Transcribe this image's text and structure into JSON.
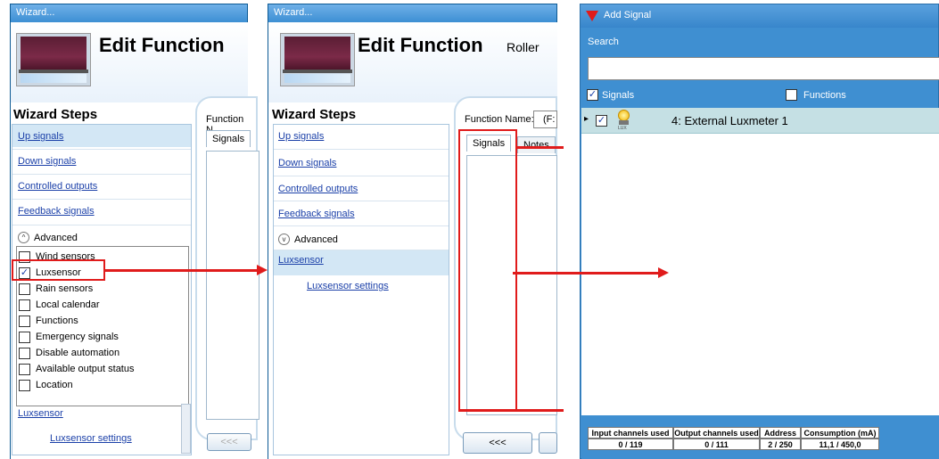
{
  "window1": {
    "title": "Wizard...",
    "header_title": "Edit Function",
    "wizard_steps_title": "Wizard Steps",
    "function_label": "Function N",
    "tab_signals": "Signals",
    "steps": [
      "Up signals",
      "Down signals",
      "Controlled outputs",
      "Feedback signals"
    ],
    "advanced_label": "Advanced",
    "checkboxes": [
      {
        "label": "Wind sensors",
        "checked": false
      },
      {
        "label": "Luxsensor",
        "checked": true
      },
      {
        "label": "Rain sensors",
        "checked": false
      },
      {
        "label": "Local calendar",
        "checked": false
      },
      {
        "label": "Functions",
        "checked": false
      },
      {
        "label": "Emergency signals",
        "checked": false
      },
      {
        "label": "Disable automation",
        "checked": false
      },
      {
        "label": "Available output status",
        "checked": false
      },
      {
        "label": "Location",
        "checked": false
      }
    ],
    "sub_step": "Luxsensor",
    "sub_sub_step": "Luxsensor settings",
    "back_button": "<<<"
  },
  "window2": {
    "title": "Wizard...",
    "header_title": "Edit Function",
    "header_subtitle": "Roller",
    "wizard_steps_title": "Wizard Steps",
    "function_name_label": "Function Name:",
    "function_name_value": "(F:",
    "tab_signals": "Signals",
    "tab_notes": "Notes",
    "steps": [
      "Up signals",
      "Down signals",
      "Controlled outputs",
      "Feedback signals"
    ],
    "advanced_label": "Advanced",
    "sub_step": "Luxsensor",
    "sub_sub_step": "Luxsensor settings",
    "back_button": "<<<"
  },
  "add_signal": {
    "title": "Add Signal",
    "search_label": "Search",
    "search_value": "",
    "signals_checkbox": "Signals",
    "signals_checked": true,
    "functions_checkbox": "Functions",
    "functions_checked": false,
    "row_label": "4: External Luxmeter 1",
    "row_checked": true,
    "icon_caption": "LUX",
    "table_headers": [
      "Input channels used",
      "Output channels used",
      "Address",
      "Consumption (mA)"
    ],
    "table_values": [
      "0 / 119",
      "0 / 111",
      "2 / 250",
      "11,1 / 450,0"
    ]
  },
  "glyphs": {
    "check": "✓",
    "up": "^",
    "down": "v",
    "expand": "▸",
    "warning": "▼"
  },
  "colors": {
    "accent_red": "#e01b1b",
    "window_blue": "#3f8fd1",
    "link_blue": "#1a3fa8",
    "selected_row": "#c5e0e4"
  }
}
